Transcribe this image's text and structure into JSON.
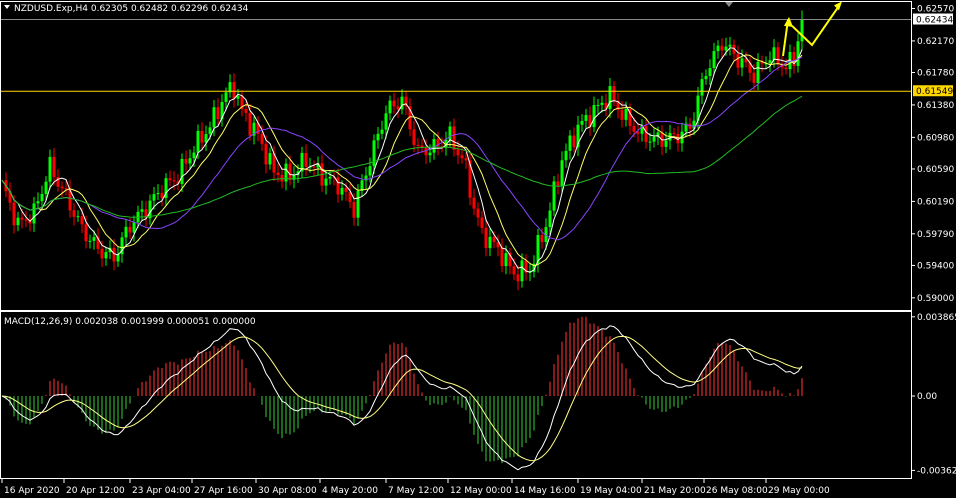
{
  "window": {
    "symbol_label": "NZDUSD.Exp,H4  0.62305 0.62482 0.62296 0.62434",
    "indicator_label": "MACD(12,26,9) 0.002038 0.001999 0.000051 0.000000"
  },
  "colors": {
    "background": "#000000",
    "frame": "#ffffff",
    "bull": "#00ff00",
    "bear": "#ff0000",
    "ma_fast": "#ffffff",
    "ma_mid": "#ffff66",
    "ma_slow_purple": "#8844ff",
    "ma_slowest_green": "#22bb22",
    "resistance_line": "#ffd700",
    "forecast_arrow": "#ffff00",
    "macd_pos": "#b22222",
    "macd_neg": "#228b22",
    "macd_main": "#ffffff",
    "macd_signal": "#ffff88"
  },
  "chart_data": [
    {
      "type": "candlestick",
      "title": "NZDUSD.Exp,H4  0.62305 0.62482 0.62296 0.62434",
      "ylim": [
        0.5885,
        0.6265
      ],
      "y_ticks": [
        "0.62570",
        "0.62170",
        "0.61780",
        "0.61380",
        "0.60980",
        "0.60590",
        "0.60190",
        "0.59790",
        "0.59400",
        "0.59000"
      ],
      "y_tick_values": [
        0.6257,
        0.6217,
        0.6178,
        0.6138,
        0.6098,
        0.6059,
        0.6019,
        0.5979,
        0.594,
        0.59
      ],
      "current_price_label": "0.62434",
      "current_price": 0.62434,
      "level_label": "0.61549",
      "level": 0.61549,
      "x_ticks": [
        "16 Apr 2020",
        "20 Apr 12:00",
        "23 Apr 04:00",
        "27 Apr 16:00",
        "30 Apr 08:00",
        "4 May 20:00",
        "7 May 12:00",
        "12 May 00:00",
        "14 May 16:00",
        "19 May 04:00",
        "21 May 20:00",
        "26 May 08:00",
        "29 May 00:00"
      ],
      "close_path": [
        [
          0,
          0.604
        ],
        [
          4,
          0.599
        ],
        [
          8,
          0.6005
        ],
        [
          12,
          0.6062
        ],
        [
          16,
          0.6025
        ],
        [
          20,
          0.5985
        ],
        [
          24,
          0.596
        ],
        [
          28,
          0.595
        ],
        [
          32,
          0.599
        ],
        [
          36,
          0.601
        ],
        [
          40,
          0.6035
        ],
        [
          44,
          0.605
        ],
        [
          48,
          0.6085
        ],
        [
          52,
          0.6112
        ],
        [
          56,
          0.6152
        ],
        [
          58,
          0.616
        ],
        [
          60,
          0.613
        ],
        [
          64,
          0.61
        ],
        [
          68,
          0.6055
        ],
        [
          72,
          0.605
        ],
        [
          76,
          0.607
        ],
        [
          80,
          0.605
        ],
        [
          84,
          0.604
        ],
        [
          88,
          0.601
        ],
        [
          92,
          0.607
        ],
        [
          96,
          0.613
        ],
        [
          100,
          0.6145
        ],
        [
          104,
          0.608
        ],
        [
          108,
          0.6085
        ],
        [
          112,
          0.61
        ],
        [
          116,
          0.606
        ],
        [
          118,
          0.601
        ],
        [
          120,
          0.598
        ],
        [
          124,
          0.596
        ],
        [
          128,
          0.593
        ],
        [
          132,
          0.5935
        ],
        [
          136,
          0.599
        ],
        [
          140,
          0.607
        ],
        [
          144,
          0.611
        ],
        [
          148,
          0.613
        ],
        [
          152,
          0.615
        ],
        [
          156,
          0.612
        ],
        [
          160,
          0.61
        ],
        [
          164,
          0.6095
        ],
        [
          168,
          0.6098
        ],
        [
          172,
          0.611
        ],
        [
          176,
          0.618
        ],
        [
          180,
          0.6215
        ],
        [
          184,
          0.6195
        ],
        [
          188,
          0.6175
        ],
        [
          192,
          0.62
        ],
        [
          196,
          0.6185
        ],
        [
          198,
          0.6195
        ],
        [
          200,
          0.6243
        ]
      ],
      "ma_fast_shift": 2,
      "ma_mid_shift": 5,
      "ma_slow_purple_shift": 9,
      "ma_slowest_green_shift": 20,
      "forecast_arrow": [
        [
          0.6243
        ],
        [
          0.6212
        ],
        [
          0.6262
        ]
      ]
    },
    {
      "type": "histogram+line",
      "title": "MACD(12,26,9) 0.002038 0.001999 0.000051 0.000000",
      "ylim": [
        -0.004,
        0.0041
      ],
      "y_ticks": [
        "0.003865",
        "0.00",
        "-0.003629"
      ],
      "y_tick_values": [
        0.003865,
        0,
        -0.003629
      ]
    }
  ]
}
